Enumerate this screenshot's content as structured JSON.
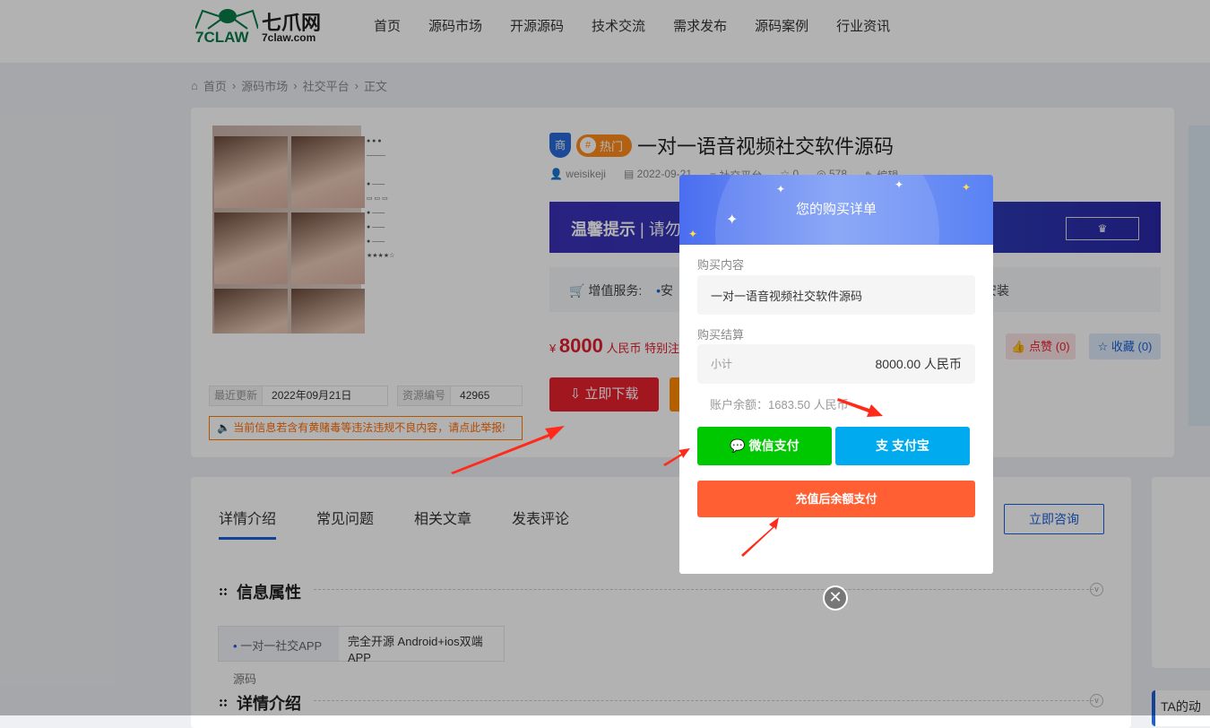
{
  "header": {
    "logo_cn": "七爪网",
    "logo_en": "7CLAW",
    "logo_domain": "7claw.com",
    "nav": [
      "首页",
      "源码市场",
      "开源源码",
      "技术交流",
      "需求发布",
      "源码案例",
      "行业资讯"
    ]
  },
  "breadcrumb": [
    "首页",
    "源码市场",
    "社交平台",
    "正文"
  ],
  "product": {
    "badge_shop": "商",
    "badge_hot": "热门",
    "title": "一对一语音视频社交软件源码",
    "author": "weisikeji",
    "date": "2022-09-21",
    "category": "社交平台",
    "likes_meta": "0",
    "views": "578",
    "edit": "编辑",
    "banner_title": "温馨提示",
    "banner_text": "请勿",
    "service_label": "增值服务:",
    "service_item": "安",
    "service_tail": "安装",
    "currency": "¥",
    "price": "8000",
    "price_unit": "人民币",
    "price_note": "特别注",
    "like_label": "点赞 (0)",
    "fav_label": "收藏 (0)",
    "download_label": "立即下载",
    "update_key": "最近更新",
    "update_val": "2022年09月21日",
    "id_key": "资源编号",
    "id_val": "42965",
    "report": "当前信息若含有黄赌毒等违法违规不良内容，请点此举报!"
  },
  "detail": {
    "tabs": [
      "详情介绍",
      "常见问题",
      "相关文章",
      "发表评论"
    ],
    "consult": "立即咨询",
    "section1": "信息属性",
    "row_key": "一对一社交APP",
    "row_val": "完全开源 Android+ios双端APP",
    "row_key2": "源码",
    "section2": "详情介绍",
    "side_title": "TA的动"
  },
  "modal": {
    "title": "您的购买详单",
    "content_label": "购买内容",
    "content_value": "一对一语音视频社交软件源码",
    "settle_label": "购买结算",
    "subtotal_label": "小计",
    "subtotal_value": "8000.00 人民币",
    "balance": "账户余额：1683.50 人民币",
    "wechat": "微信支付",
    "alipay": "支付宝",
    "recharge": "充值后余额支付",
    "close": "✕"
  },
  "colors": {
    "accent": "#1a5fd8",
    "wechat": "#00c800",
    "alipay": "#00aaee",
    "recharge": "#ff5f33",
    "arrow": "#ff2a1a"
  }
}
